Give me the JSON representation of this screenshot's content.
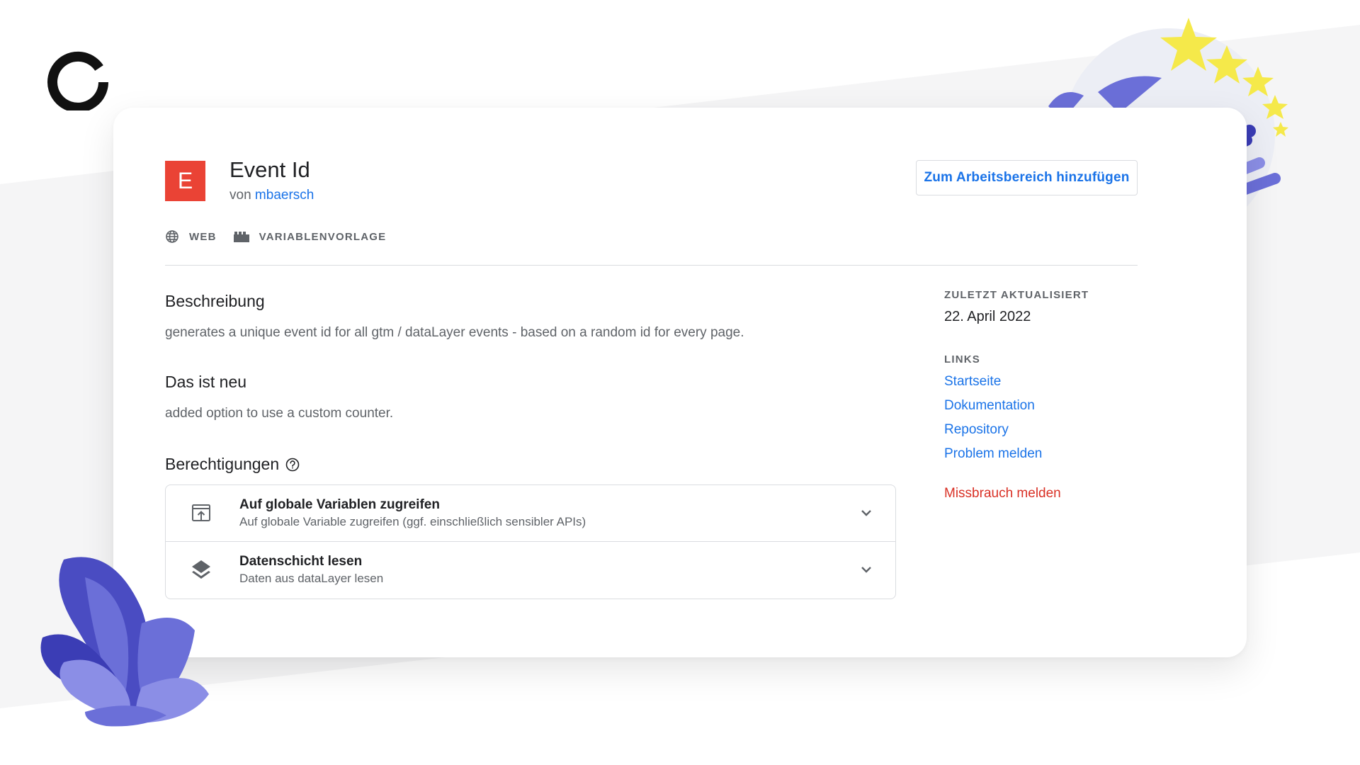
{
  "template": {
    "initial": "E",
    "title": "Event Id",
    "author_prefix": "von",
    "author": "mbaersch",
    "add_button_label": "Zum Arbeitsbereich hinzufügen",
    "tags": [
      {
        "icon": "globe-icon",
        "label": "WEB"
      },
      {
        "icon": "template-blocks-icon",
        "label": "VARIABLENVORLAGE"
      }
    ],
    "tile_color": "#ea4335"
  },
  "main": {
    "description_title": "Beschreibung",
    "description_text": "generates a unique event id for all gtm / dataLayer events - based on a random id for every page.",
    "whats_new_title": "Das ist neu",
    "whats_new_text": "added option to use a custom counter.",
    "permissions_title": "Berechtigungen",
    "permissions": [
      {
        "icon": "open-in-browser-icon",
        "name": "Auf globale Variablen zugreifen",
        "description": "Auf globale Variable zugreifen (ggf. einschließlich sensibler APIs)"
      },
      {
        "icon": "layers-icon",
        "name": "Datenschicht lesen",
        "description": "Daten aus dataLayer lesen"
      }
    ]
  },
  "sidebar": {
    "updated_label": "ZULETZT AKTUALISIERT",
    "updated_value": "22. April 2022",
    "links_label": "LINKS",
    "links": [
      "Startseite",
      "Dokumentation",
      "Repository",
      "Problem melden"
    ],
    "abuse_link": "Missbrauch melden"
  },
  "colors": {
    "link": "#1a73e8",
    "danger": "#d93025",
    "accent_purple": "#6b6fd8",
    "star_yellow": "#f5e94a"
  }
}
